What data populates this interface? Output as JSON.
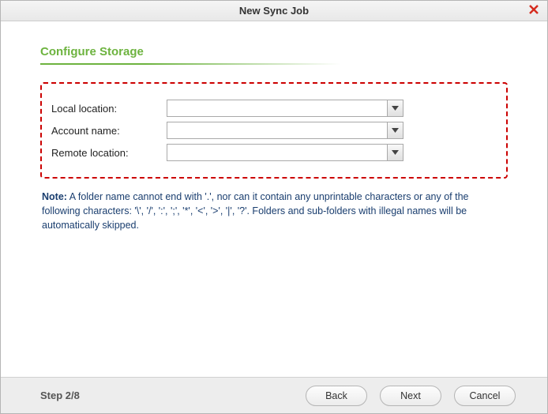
{
  "window": {
    "title": "New Sync Job"
  },
  "section": {
    "heading": "Configure Storage"
  },
  "fields": {
    "local_location": {
      "label": "Local location:",
      "value": ""
    },
    "account_name": {
      "label": "Account name:",
      "value": ""
    },
    "remote_location": {
      "label": "Remote location:",
      "value": ""
    }
  },
  "note": {
    "prefix": "Note:",
    "text": " A folder name cannot end with '.', nor can it contain any unprintable characters or any of the following characters: '\\', '/', ':', ';', '*', '<', '>', '|', '?'. Folders and sub-folders with illegal names will be automatically skipped."
  },
  "footer": {
    "step": "Step 2/8",
    "back": "Back",
    "next": "Next",
    "cancel": "Cancel"
  }
}
